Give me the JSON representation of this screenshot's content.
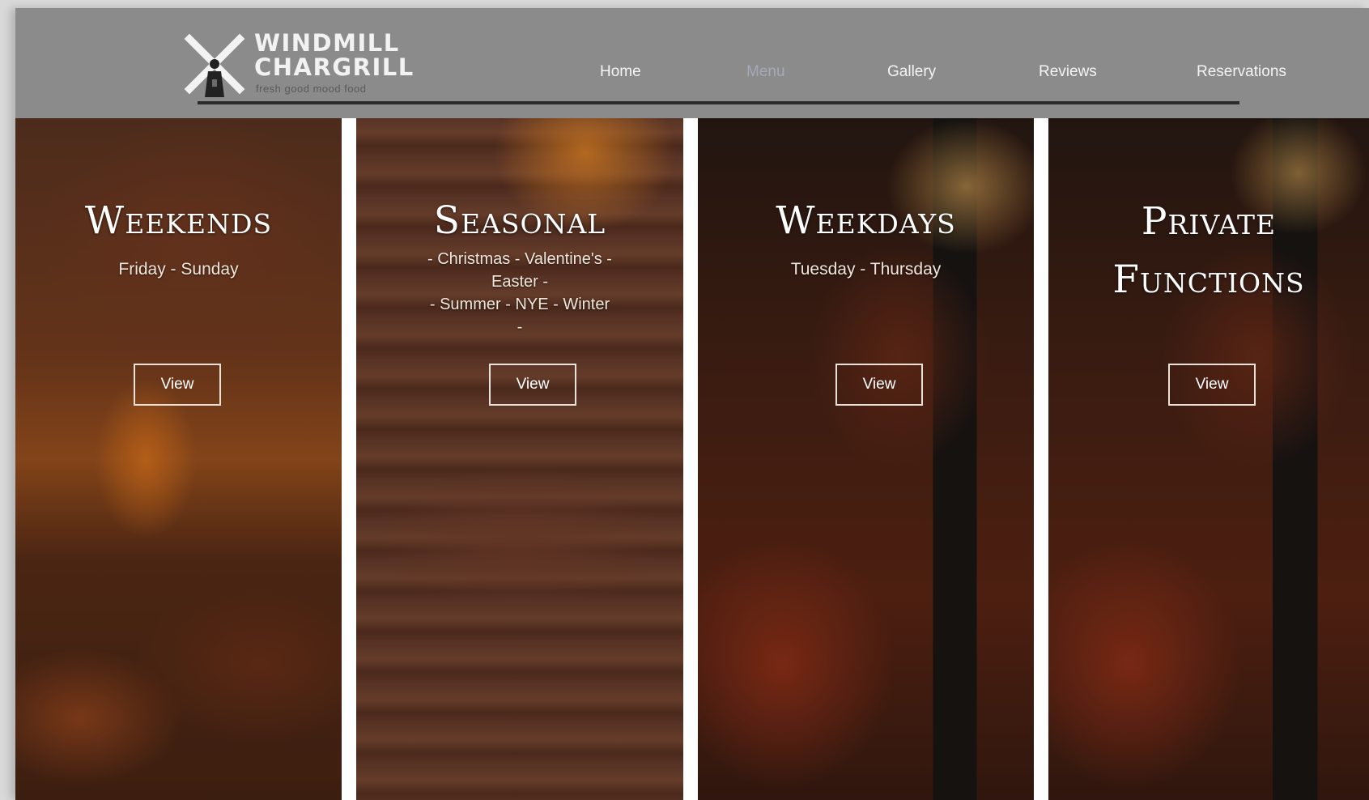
{
  "brand": {
    "name_line1": "WINDMILL",
    "name_line2": "CHARGRILL",
    "tagline": "fresh good mood food"
  },
  "nav": {
    "items": [
      {
        "label": "Home",
        "active": false
      },
      {
        "label": "Menu",
        "active": true
      },
      {
        "label": "Gallery",
        "active": false
      },
      {
        "label": "Reviews",
        "active": false
      },
      {
        "label": "Reservations",
        "active": false
      }
    ]
  },
  "panels": [
    {
      "title": "Weekends",
      "subtitle": "Friday - Sunday",
      "button": "View"
    },
    {
      "title": "Seasonal",
      "subtitle": "- Christmas - Valentine's -\nEaster -\n- Summer - NYE - Winter\n-",
      "button": "View"
    },
    {
      "title": "Weekdays",
      "subtitle": "Tuesday - Thursday",
      "button": "View"
    },
    {
      "title": "Private Functions",
      "subtitle": "",
      "button": "View"
    }
  ],
  "colors": {
    "header_bg": "#8b8b8b",
    "nav_active": "#a6a9b7",
    "header_rule": "#2b2b2b"
  }
}
